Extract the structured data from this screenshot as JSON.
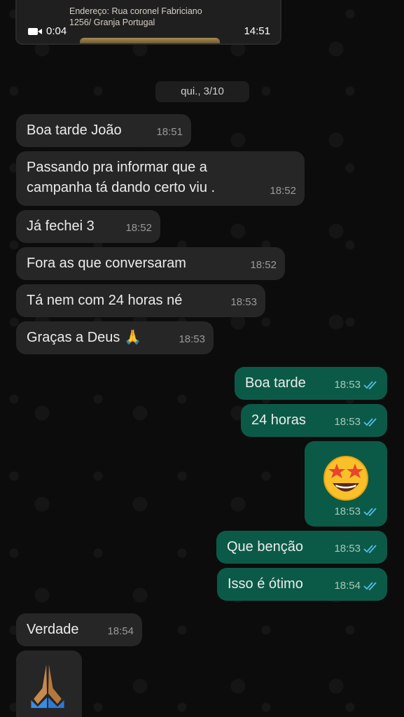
{
  "top_card": {
    "address_line1": "Endereço: Rua coronel Fabriciano",
    "address_line2": "1256/ Granja Portugal",
    "duration": "0:04",
    "time": "14:51"
  },
  "date_pill": "qui., 3/10",
  "colors": {
    "incoming": "#262626",
    "outgoing": "#0b5a47",
    "read_ticks": "#53bdeb"
  },
  "messages": [
    {
      "dir": "in",
      "text": "Boa tarde João",
      "time": "18:51"
    },
    {
      "dir": "in",
      "text": "Passando pra informar que a\ncampanha tá dando certo viu .",
      "time": "18:52"
    },
    {
      "dir": "in",
      "text": "Já fechei 3",
      "time": "18:52"
    },
    {
      "dir": "in",
      "text": "Fora as que conversaram",
      "time": "18:52"
    },
    {
      "dir": "in",
      "text": "Tá nem com 24 horas né",
      "time": "18:53"
    },
    {
      "dir": "in",
      "text": "Graças a Deus 🙏",
      "time": "18:53"
    },
    {
      "dir": "out",
      "text": "Boa tarde",
      "time": "18:53",
      "status": "read"
    },
    {
      "dir": "out",
      "text": "24 horas",
      "time": "18:53",
      "status": "read"
    },
    {
      "dir": "out",
      "emoji": "star-struck",
      "time": "18:53",
      "status": "read"
    },
    {
      "dir": "out",
      "text": "Que benção",
      "time": "18:53",
      "status": "read"
    },
    {
      "dir": "out",
      "text": "Isso é ótimo",
      "time": "18:54",
      "status": "read"
    },
    {
      "dir": "in",
      "text": "Verdade",
      "time": "18:54"
    },
    {
      "dir": "in",
      "emoji": "folded-hands"
    }
  ]
}
